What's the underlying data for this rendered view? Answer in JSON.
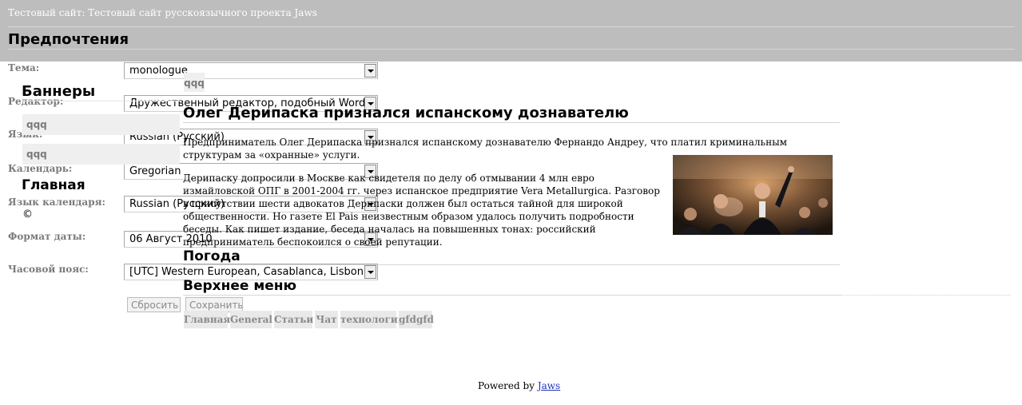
{
  "header": {
    "site_title": "Тестовый сайт: Тестовый сайт русскоязычного проекта Jaws",
    "page_title": "Предпочтения"
  },
  "preferences_form": {
    "fields": [
      {
        "label": "Тема:",
        "value": "monologue"
      },
      {
        "label": "Редактор:",
        "value": "Дружественный редактор, подобный Word / OpenOffice"
      },
      {
        "label": "Язык:",
        "value": "Russian (Русский)"
      },
      {
        "label": "Календарь:",
        "value": "Gregorian"
      },
      {
        "label": "Язык календаря:",
        "value": "Russian (Русский)"
      },
      {
        "label": "Формат даты:",
        "value": "06 Август 2010"
      },
      {
        "label": "Часовой пояс:",
        "value": "[UTC] Western European, Casablanca, Lisbon, London"
      }
    ],
    "reset_label": "Сбросить",
    "save_label": "Сохранить"
  },
  "sidebar": {
    "banners_title": "Баннеры",
    "banner_1": "qqq",
    "banner_2": "qqq",
    "banner_3": "qqq",
    "main_title": "Главная",
    "copyright": "©"
  },
  "article": {
    "title": "Олег Дерипаска признался испанскому дознавателю",
    "lead": "Предприниматель Олег Дерипаска признался испанскому дознавателю Фернандо Андреу, что платил криминальным структурам за «охранные» услуги.",
    "body": "Дерипаску допросили в Москве как свидетеля по делу об отмывании 4 млн евро измайловской ОПГ в 2001-2004 гг. через испанское предприятие Vera Metallurgica. Разговор в присутствии шести адвокатов Дерипаски должен был остаться тайной для широкой общественности. Но газете El Pais неизвестным образом удалось получить подробности беседы. Как пишет издание, беседа началась на повышенных тонах: российский предприниматель беспокоился о своей репутации."
  },
  "weather": {
    "title": "Погода"
  },
  "top_menu": {
    "title": "Верхнее меню",
    "items": [
      "Главная",
      "General",
      "Статьи",
      "Чат",
      "технологии",
      "gfdgfd"
    ]
  },
  "footer": {
    "powered_by": "Powered by",
    "link": "Jaws"
  }
}
